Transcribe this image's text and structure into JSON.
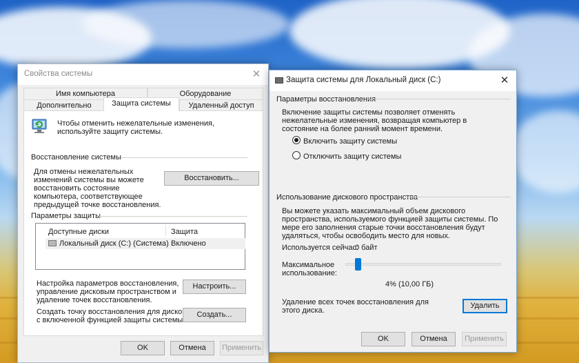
{
  "system_properties": {
    "title": "Свойства системы",
    "tabs_row1": [
      "Имя компьютера",
      "Оборудование"
    ],
    "tabs_row2": [
      "Дополнительно",
      "Защита системы",
      "Удаленный доступ"
    ],
    "intro": "Чтобы отменить нежелательные изменения, используйте защиту системы.",
    "restore_heading": "Восстановление системы",
    "restore_desc": "Для отмены нежелательных изменений системы вы можете восстановить состояние компьютера, соответствующее предыдущей точке восстановления.",
    "restore_button": "Восстановить...",
    "protection_heading": "Параметры защиты",
    "list_headers": [
      "Доступные диски",
      "Защита"
    ],
    "drive_name": "Локальный диск (C:) (Система)",
    "drive_status": "Включено",
    "configure_desc": "Настройка параметров восстановления, управление дисковым пространством и удаление точек восстановления.",
    "configure_button": "Настроить...",
    "create_desc": "Создать точку восстановления для дисков с включенной функцией защиты системы.",
    "create_button": "Создать...",
    "ok": "OK",
    "cancel": "Отмена",
    "apply": "Применить"
  },
  "disk_protection": {
    "title": "Защита системы для Локальный диск (C:)",
    "restore_settings_heading": "Параметры восстановления",
    "restore_settings_desc": "Включение защиты системы позволяет отменять нежелательные изменения, возвращая компьютер в состояние на более ранний момент времени.",
    "option_enable": "Включить защиту системы",
    "option_disable": "Отключить защиту системы",
    "selected_option": "enable",
    "disk_usage_heading": "Использование дискового пространства",
    "disk_usage_desc": "Вы можете указать максимальный объем дискового пространства, используемого функцией защиты системы. По мере его заполнения старые точки восстановления будут удаляться, чтобы освободить место для новых.",
    "current_usage_label": "Используется сейчас:",
    "current_usage_value": "0 байт",
    "max_usage_label": "Максимальное использование:",
    "max_usage_fraction": 0.04,
    "max_usage_text": "4% (10,00 ГБ)",
    "delete_desc": "Удаление всех точек восстановления для этого диска.",
    "delete_button": "Удалить",
    "ok": "OK",
    "cancel": "Отмена",
    "apply": "Применить"
  }
}
